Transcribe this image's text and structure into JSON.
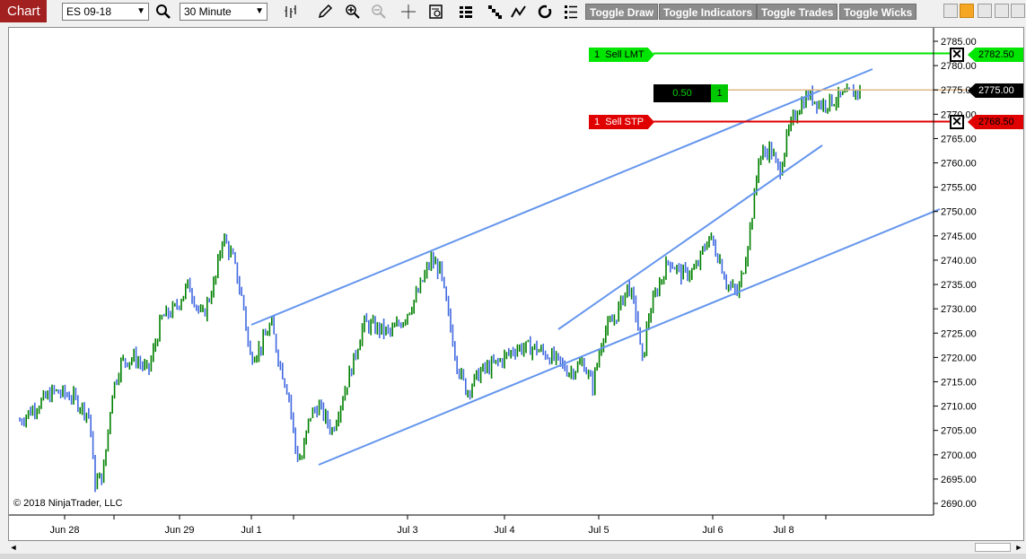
{
  "toolbar": {
    "chart_tab": "Chart",
    "instrument": "ES 09-18",
    "interval": "30 Minute",
    "toggle_draw": "Toggle Draw",
    "toggle_indicators": "Toggle Indicators",
    "toggle_trades": "Toggle Trades",
    "toggle_wicks": "Toggle Wicks",
    "icons": [
      "magnifier-icon",
      "bar-chart-style-icon",
      "pencil-icon",
      "zoom-in-icon",
      "zoom-out-icon",
      "crosshair-icon",
      "data-box-icon",
      "bar-type-icon",
      "stairs-icon",
      "indicator-icon",
      "strategy-icon",
      "properties-icon"
    ]
  },
  "chart": {
    "copyright": "© 2018 NinjaTrader, LLC",
    "price_axis_labels": [
      "2785.00",
      "2780.00",
      "2775.00",
      "2770.00",
      "2765.00",
      "2760.00",
      "2755.00",
      "2750.00",
      "2745.00",
      "2740.00",
      "2735.00",
      "2730.00",
      "2725.00",
      "2720.00",
      "2715.00",
      "2710.00",
      "2705.00",
      "2700.00",
      "2695.00",
      "2690.00"
    ],
    "date_labels": [
      "Jun 28",
      "Jun 29",
      "Jul 1",
      "Jul 3",
      "Jul 4",
      "Jul 5",
      "Jul 6",
      "Jul 8"
    ],
    "colors": {
      "up_bar": "#008000",
      "down_bar": "#4169e1",
      "trendline": "#6495ed",
      "sell_lmt": "#00e600",
      "sell_stp": "#e00000",
      "position": "#deb887"
    }
  },
  "orders": {
    "sell_lmt": {
      "qty": "1",
      "label": "Sell LMT",
      "price": "2782.50"
    },
    "sell_stp": {
      "qty": "1",
      "label": "Sell STP",
      "price": "2768.50"
    },
    "position": {
      "pnl": "0.50",
      "qty": "1",
      "price": "2775.00"
    }
  }
}
